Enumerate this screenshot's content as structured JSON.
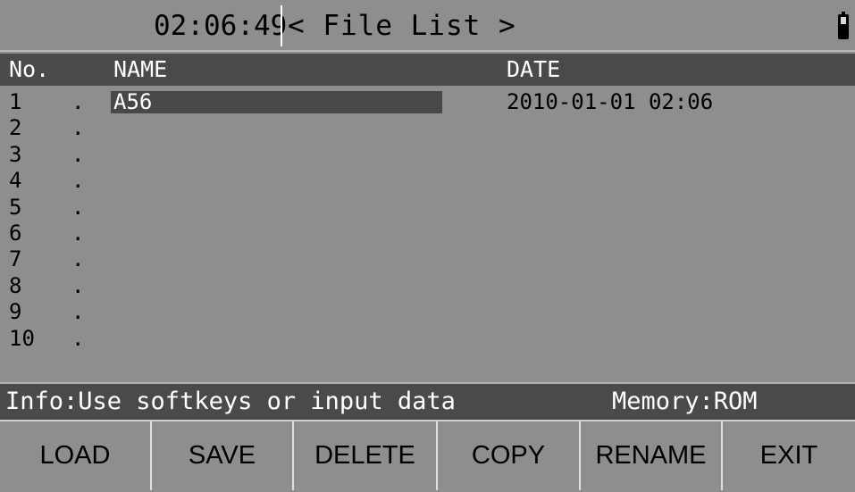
{
  "titlebar": {
    "time": "02:06:49",
    "title": "< File List >",
    "battery_icon": "battery-icon"
  },
  "header": {
    "no": "No.",
    "name": "NAME",
    "date": "DATE"
  },
  "files": [
    {
      "no": "1",
      "name": "A56",
      "date": "2010-01-01 02:06",
      "selected": true
    },
    {
      "no": "2",
      "name": "",
      "date": ""
    },
    {
      "no": "3",
      "name": "",
      "date": ""
    },
    {
      "no": "4",
      "name": "",
      "date": ""
    },
    {
      "no": "5",
      "name": "",
      "date": ""
    },
    {
      "no": "6",
      "name": "",
      "date": ""
    },
    {
      "no": "7",
      "name": "",
      "date": ""
    },
    {
      "no": "8",
      "name": "",
      "date": ""
    },
    {
      "no": "9",
      "name": "",
      "date": ""
    },
    {
      "no": "10",
      "name": "",
      "date": ""
    }
  ],
  "row_dot": ".",
  "info": {
    "message": "Info:Use softkeys or input data",
    "memory": "Memory:ROM"
  },
  "softkeys": [
    "LOAD",
    "SAVE",
    "DELETE",
    "COPY",
    "RENAME",
    "EXIT"
  ],
  "colors": {
    "background": "#8e8e8e",
    "header_bar": "#4a4a4a",
    "selection": "#484848",
    "text": "#000000",
    "header_text": "#ffffff"
  }
}
